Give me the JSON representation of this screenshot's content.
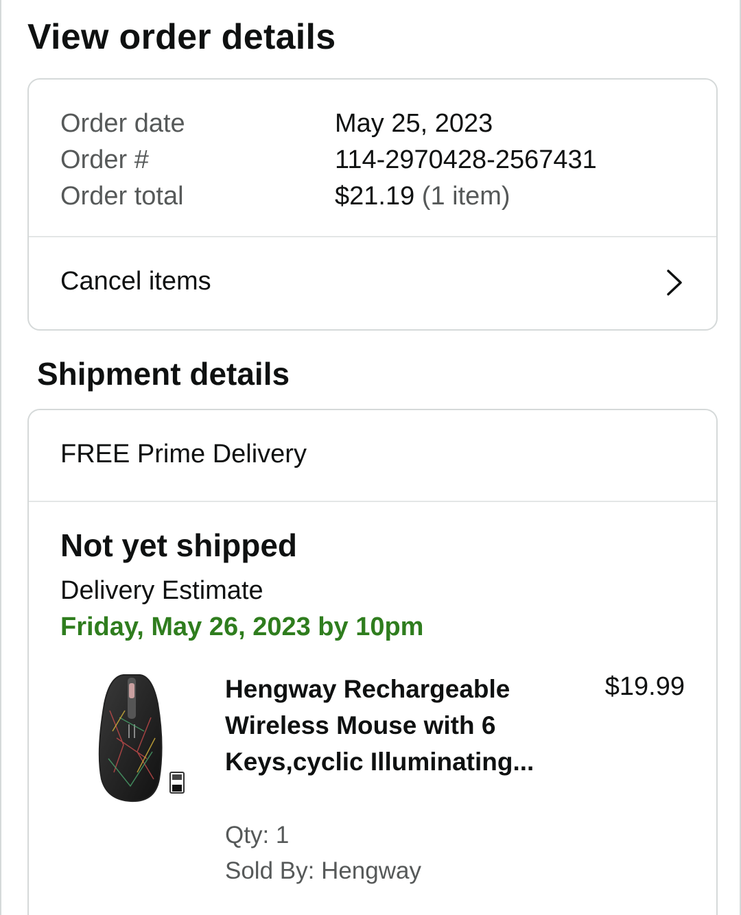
{
  "page": {
    "title": "View order details"
  },
  "order": {
    "rows": [
      {
        "label": "Order date",
        "value": "May 25, 2023"
      },
      {
        "label": "Order #",
        "value": "114-2970428-2567431"
      },
      {
        "label": "Order total",
        "value": "$21.19",
        "note": "(1 item)"
      }
    ],
    "cancel_label": "Cancel items"
  },
  "shipment": {
    "section_title": "Shipment details",
    "delivery_type": "FREE Prime Delivery",
    "status": "Not yet shipped",
    "estimate_label": "Delivery Estimate",
    "estimate_date": "Friday, May 26, 2023 by 10pm",
    "estimate_color": "#2f7d1e",
    "item": {
      "title": "Hengway Rechargeable Wireless Mouse with 6 Keys,cyclic Illuminating...",
      "price": "$19.99",
      "qty": "Qty: 1",
      "sold_by": "Sold By: Hengway",
      "image_icon": "wireless-mouse-product-image"
    }
  }
}
